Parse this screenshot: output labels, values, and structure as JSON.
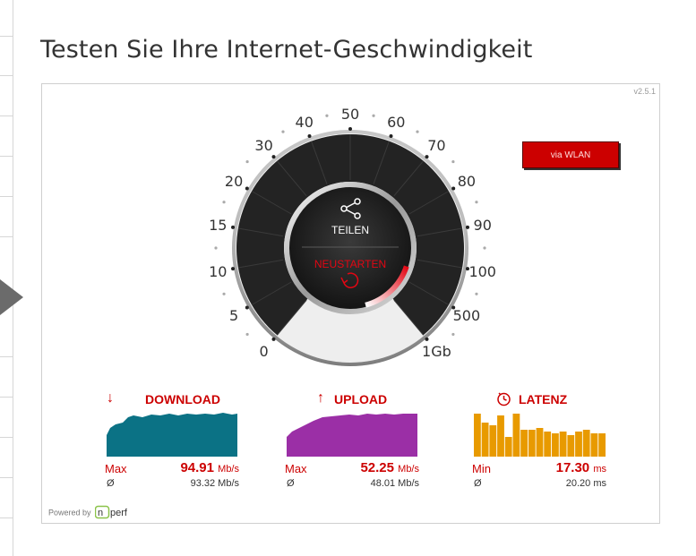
{
  "page": {
    "title": "Testen Sie Ihre Internet-Geschwindigkeit"
  },
  "widget": {
    "version": "v2.5.1",
    "wlan_button": "via WLAN",
    "gauge": {
      "scale_labels": [
        "0",
        "5",
        "10",
        "15",
        "20",
        "30",
        "40",
        "50",
        "60",
        "70",
        "80",
        "90",
        "100",
        "500",
        "1Gb"
      ],
      "share_label": "TEILEN",
      "restart_label": "NEUSTARTEN",
      "colors": {
        "face": "#232323",
        "accent": "#e30613",
        "empty": "#efefef"
      }
    },
    "download": {
      "label": "DOWNLOAD",
      "icon": "arrow-down-icon",
      "color": "#0b7285",
      "max_label": "Max",
      "max_value": "94.91",
      "max_unit": "Mb/s",
      "avg_symbol": "Ø",
      "avg_value": "93.32 Mb/s"
    },
    "upload": {
      "label": "UPLOAD",
      "icon": "arrow-up-icon",
      "color": "#9b2fa6",
      "max_label": "Max",
      "max_value": "52.25",
      "max_unit": "Mb/s",
      "avg_symbol": "Ø",
      "avg_value": "48.01 Mb/s"
    },
    "latency": {
      "label": "LATENZ",
      "icon": "stopwatch-icon",
      "color": "#e89a00",
      "min_label": "Min",
      "min_value": "17.30",
      "min_unit": "ms",
      "avg_symbol": "Ø",
      "avg_value": "20.20 ms"
    },
    "powered_by": "Powered by",
    "brand": "nperf"
  }
}
